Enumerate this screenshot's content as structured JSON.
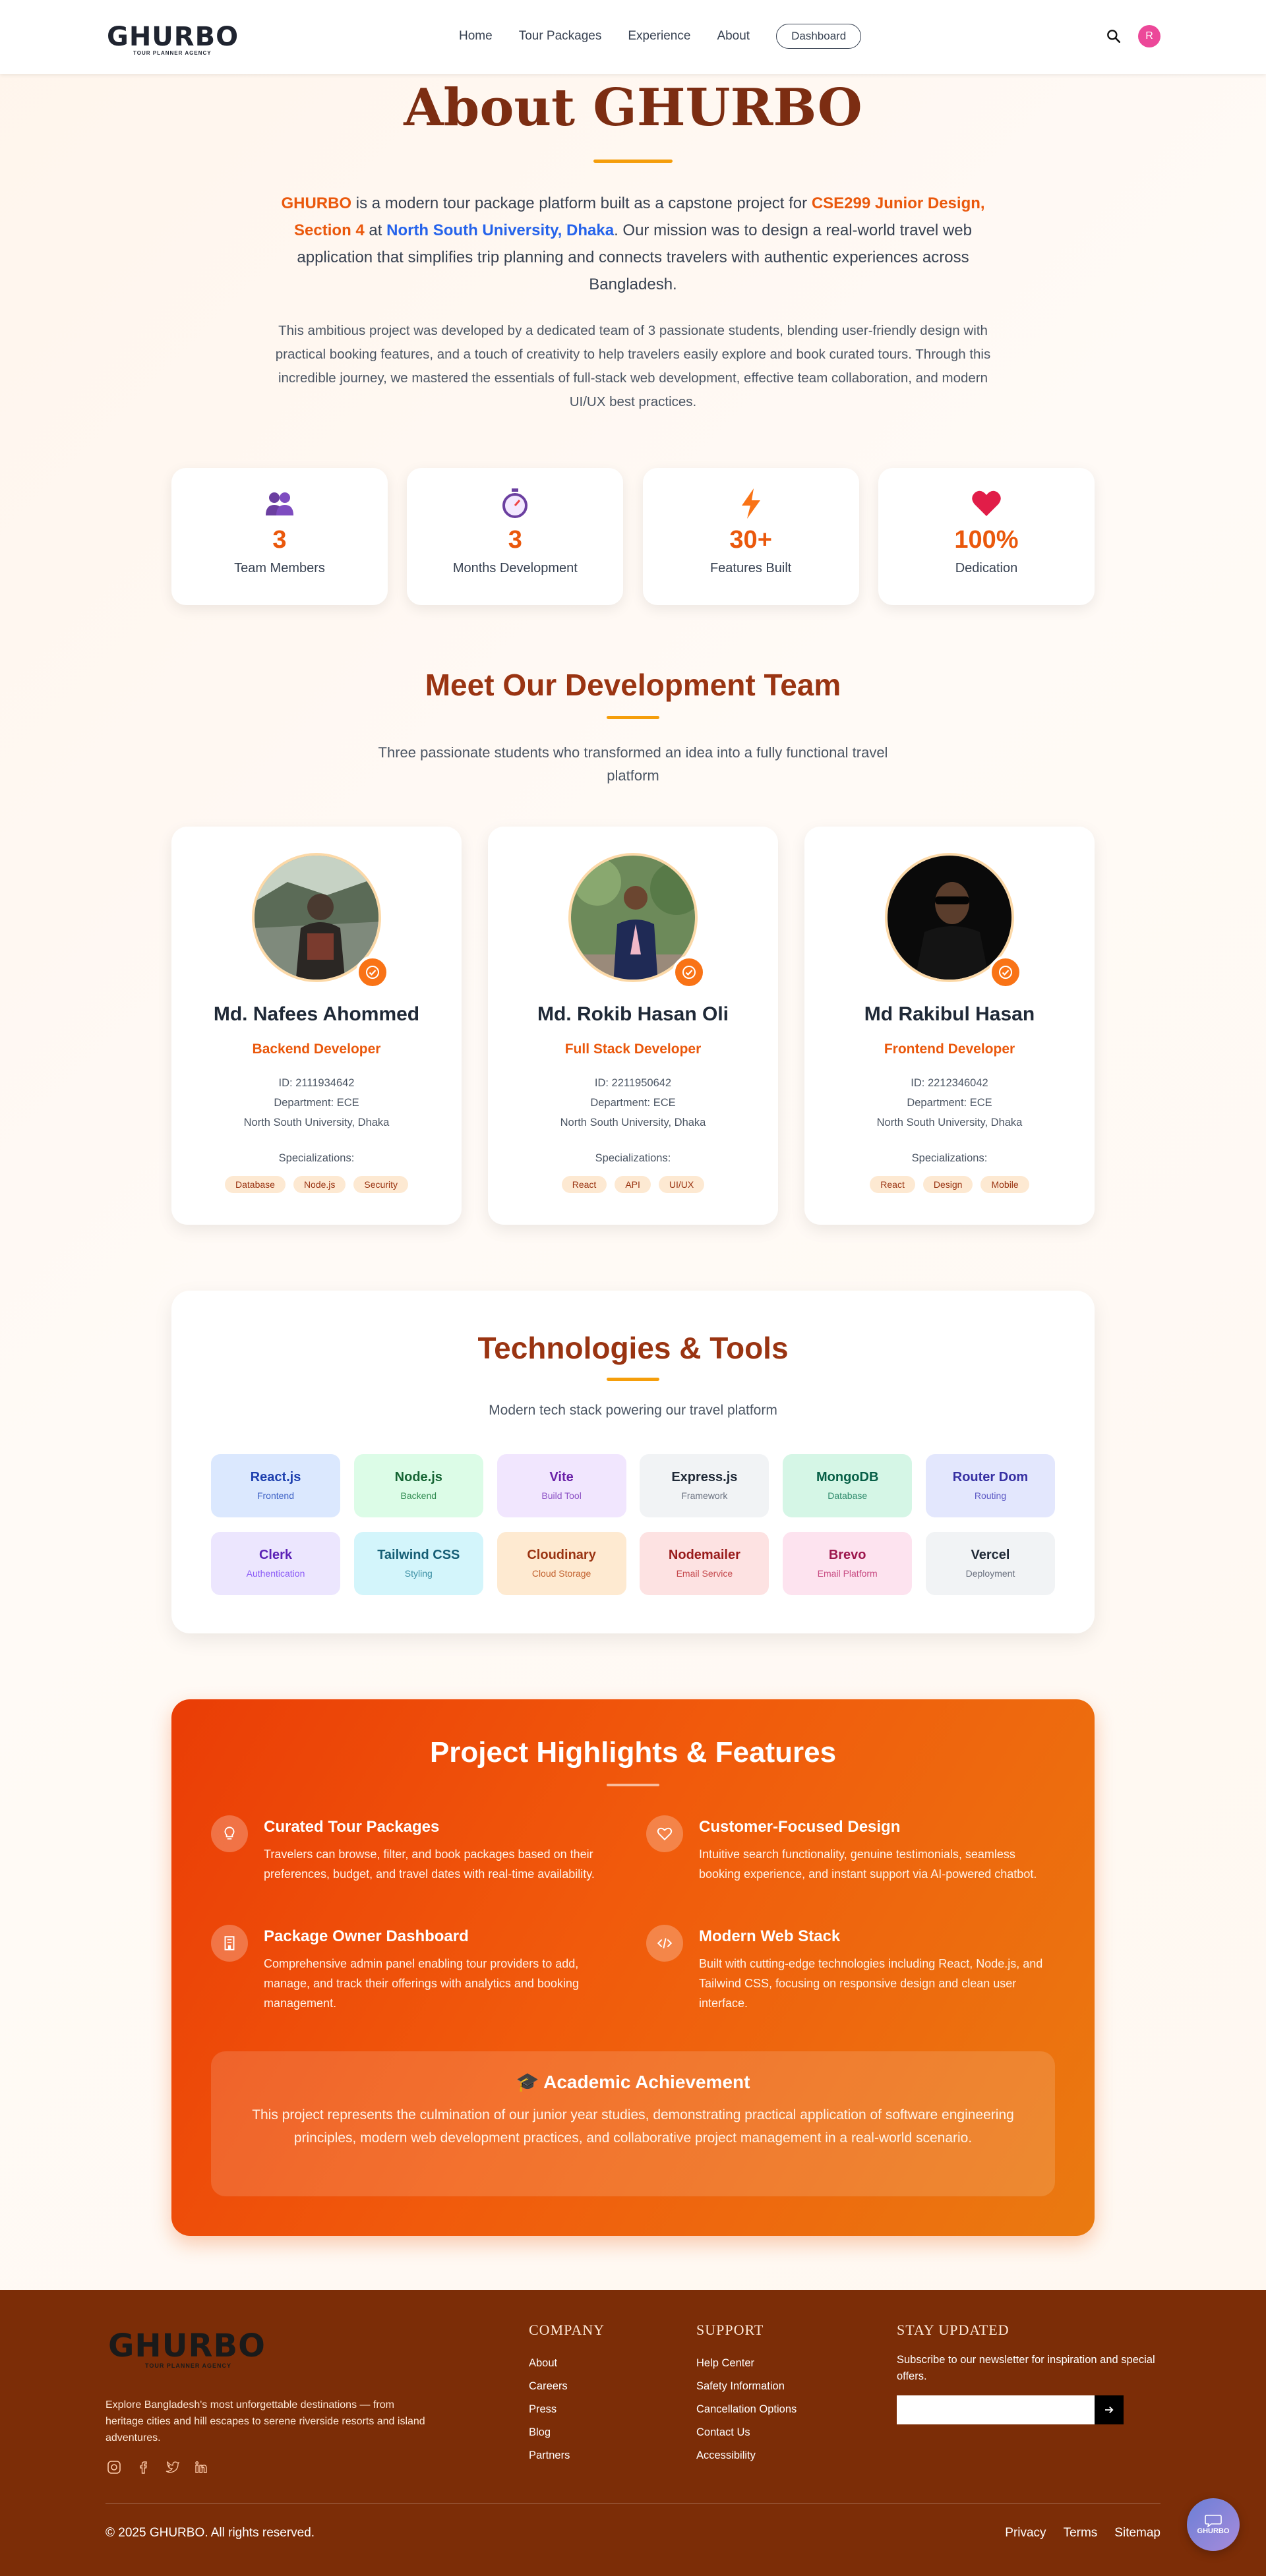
{
  "navbar": {
    "logo_text": "GHURBO",
    "logo_sub": "TOUR PLANNER AGENCY",
    "links": [
      "Home",
      "Tour Packages",
      "Experience",
      "About"
    ],
    "dashboard_label": "Dashboard",
    "avatar_initial": "R",
    "avatar_color": "#ec4899"
  },
  "hero": {
    "title": "About GHURBO",
    "intro": {
      "brand": "GHURBO",
      "p1": " is a modern tour package platform built as a capstone project for ",
      "course": "CSE299 Junior Design, Section 4",
      "p2": " at ",
      "university": "North South University, Dhaka",
      "p3": ". Our mission was to design a real-world travel web application that simplifies trip planning and connects travelers with authentic experiences across Bangladesh."
    },
    "paragraph2": "This ambitious project was developed by a dedicated team of 3 passionate students, blending user-friendly design with practical booking features, and a touch of creativity to help travelers easily explore and book curated tours. Through this incredible journey, we mastered the essentials of full-stack web development, effective team collaboration, and modern UI/UX best practices."
  },
  "stats": [
    {
      "icon": "people-icon",
      "value": "3",
      "label": "Team Members"
    },
    {
      "icon": "stopwatch-icon",
      "value": "3",
      "label": "Months Development"
    },
    {
      "icon": "lightning-icon",
      "value": "30+",
      "label": "Features Built"
    },
    {
      "icon": "heart-icon",
      "value": "100%",
      "label": "Dedication"
    }
  ],
  "team": {
    "title": "Meet Our Development Team",
    "subtitle": "Three passionate students who transformed an idea into a fully functional travel platform",
    "members": [
      {
        "name": "Md. Nafees Ahommed",
        "role": "Backend Developer",
        "id": "ID: 2111934642",
        "department": "Department: ECE",
        "university": "North South University, Dhaka",
        "spec_label": "Specializations:",
        "tags": [
          "Database",
          "Node.js",
          "Security"
        ]
      },
      {
        "name": "Md. Rokib Hasan Oli",
        "role": "Full Stack Developer",
        "id": "ID: 2211950642",
        "department": "Department: ECE",
        "university": "North South University, Dhaka",
        "spec_label": "Specializations:",
        "tags": [
          "React",
          "API",
          "UI/UX"
        ]
      },
      {
        "name": "Md Rakibul Hasan",
        "role": "Frontend Developer",
        "id": "ID: 2212346042",
        "department": "Department: ECE",
        "university": "North South University, Dhaka",
        "spec_label": "Specializations:",
        "tags": [
          "React",
          "Design",
          "Mobile"
        ]
      }
    ]
  },
  "tech": {
    "title": "Technologies & Tools",
    "subtitle": "Modern tech stack powering our travel platform",
    "items": [
      {
        "name": "React.js",
        "category": "Frontend",
        "bg": "#dbe8fe",
        "fg": "#1e40af",
        "sub": "#3b5fc4"
      },
      {
        "name": "Node.js",
        "category": "Backend",
        "bg": "#dcfce7",
        "fg": "#166534",
        "sub": "#2f8a4f"
      },
      {
        "name": "Vite",
        "category": "Build Tool",
        "bg": "#f1e6fe",
        "fg": "#6b21a8",
        "sub": "#8b4fc4"
      },
      {
        "name": "Express.js",
        "category": "Framework",
        "bg": "#f1f3f5",
        "fg": "#1f2937",
        "sub": "#6b7280"
      },
      {
        "name": "MongoDB",
        "category": "Database",
        "bg": "#d5f6e6",
        "fg": "#065f46",
        "sub": "#2e8a6b"
      },
      {
        "name": "Router Dom",
        "category": "Routing",
        "bg": "#e3e7fd",
        "fg": "#3730a3",
        "sub": "#5b58c4"
      },
      {
        "name": "Clerk",
        "category": "Authentication",
        "bg": "#ece6fe",
        "fg": "#5b21b6",
        "sub": "#8b5cf6"
      },
      {
        "name": "Tailwind CSS",
        "category": "Styling",
        "bg": "#d3f5fb",
        "fg": "#155e75",
        "sub": "#3a8ea3"
      },
      {
        "name": "Cloudinary",
        "category": "Cloud Storage",
        "bg": "#feead1",
        "fg": "#9a3412",
        "sub": "#c2612e"
      },
      {
        "name": "Nodemailer",
        "category": "Email Service",
        "bg": "#fde2e2",
        "fg": "#991b1b",
        "sub": "#c4474b"
      },
      {
        "name": "Brevo",
        "category": "Email Platform",
        "bg": "#fde3ef",
        "fg": "#9d174d",
        "sub": "#c84c83"
      },
      {
        "name": "Vercel",
        "category": "Deployment",
        "bg": "#f1f3f5",
        "fg": "#1f2937",
        "sub": "#6b7280"
      }
    ]
  },
  "highlights": {
    "title": "Project Highlights & Features",
    "features": [
      {
        "icon": "lightbulb-icon",
        "title": "Curated Tour Packages",
        "desc": "Travelers can browse, filter, and book packages based on their preferences, budget, and travel dates with real-time availability."
      },
      {
        "icon": "heart-outline-icon",
        "title": "Customer-Focused Design",
        "desc": "Intuitive search functionality, genuine testimonials, seamless booking experience, and instant support via AI-powered chatbot."
      },
      {
        "icon": "building-icon",
        "title": "Package Owner Dashboard",
        "desc": "Comprehensive admin panel enabling tour providers to add, manage, and track their offerings with analytics and booking management."
      },
      {
        "icon": "code-icon",
        "title": "Modern Web Stack",
        "desc": "Built with cutting-edge technologies including React, Node.js, and Tailwind CSS, focusing on responsive design and clean user interface."
      }
    ],
    "achievement_title": "🎓 Academic Achievement",
    "achievement_desc": "This project represents the culmination of our junior year studies, demonstrating practical application of software engineering principles, modern web development practices, and collaborative project management in a real-world scenario."
  },
  "footer": {
    "logo_text": "GHURBO",
    "logo_sub": "TOUR PLANNER AGENCY",
    "about": "Explore Bangladesh's most unforgettable destinations — from heritage cities and hill escapes to serene riverside resorts and island adventures.",
    "social": [
      "instagram-icon",
      "facebook-icon",
      "twitter-icon",
      "linkedin-icon"
    ],
    "company_title": "COMPANY",
    "company_links": [
      "About",
      "Careers",
      "Press",
      "Blog",
      "Partners"
    ],
    "support_title": "SUPPORT",
    "support_links": [
      "Help Center",
      "Safety Information",
      "Cancellation Options",
      "Contact Us",
      "Accessibility"
    ],
    "news_title": "STAY UPDATED",
    "news_desc": "Subscribe to our newsletter for inspiration and special offers.",
    "news_placeholder": "",
    "copyright": "© 2025 GHURBO. All rights reserved.",
    "bottom_links": [
      "Privacy",
      "Terms",
      "Sitemap"
    ]
  },
  "chat": {
    "label": "GHURBO"
  }
}
